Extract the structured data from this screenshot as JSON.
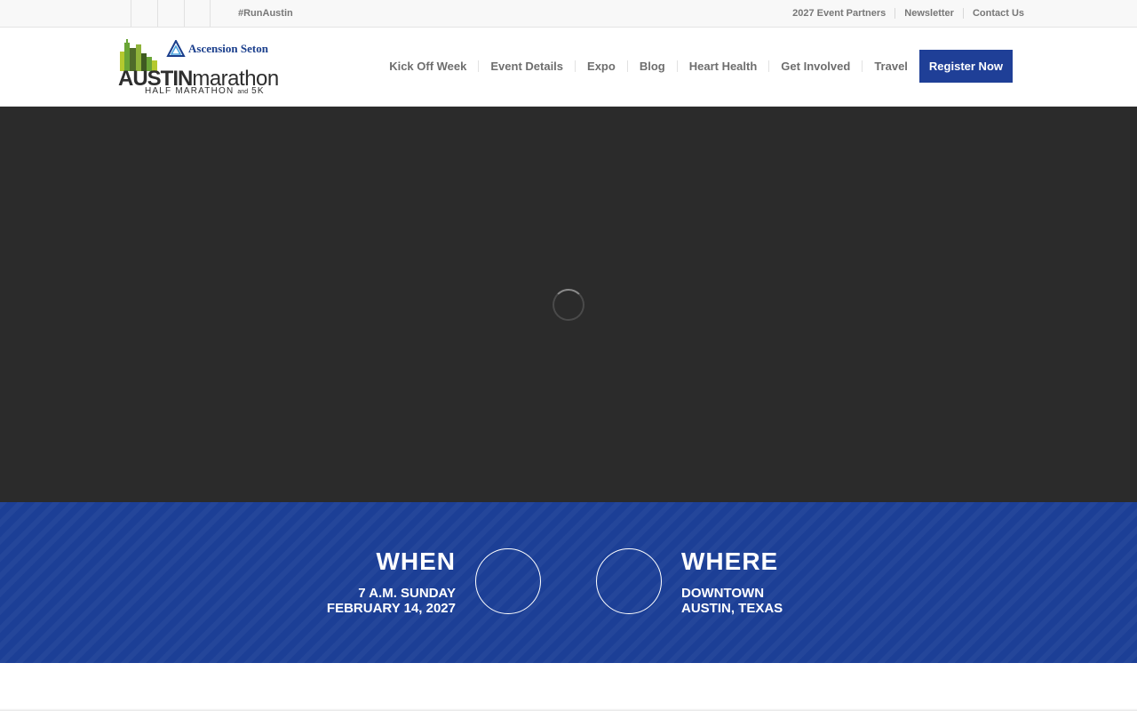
{
  "topbar": {
    "hashtag": "#RunAustin",
    "links": [
      "2027 Event Partners",
      "Newsletter",
      "Contact Us"
    ],
    "social_icons": [
      "social-icon",
      "social-icon",
      "social-icon"
    ]
  },
  "logo": {
    "sponsor": "Ascension Seton",
    "wordmark_bold": "AUSTIN",
    "wordmark_light": "marathon",
    "tagline_main": "HALF MARATHON",
    "tagline_small": "and",
    "tagline_end": "5K",
    "colors": {
      "skyline_green": "#6aa536",
      "skyline_olive": "#4f6b2a",
      "skyline_lime": "#b4c92e",
      "seton_blue": "#1a3e8c"
    }
  },
  "nav": {
    "items": [
      "Kick Off Week",
      "Event Details",
      "Expo",
      "Blog",
      "Heart Health",
      "Get Involved",
      "Travel"
    ],
    "cta": "Register Now"
  },
  "hero": {
    "state": "loading"
  },
  "band": {
    "when": {
      "title": "WHEN",
      "line1": "7 A.M. SUNDAY",
      "line2": "FEBRUARY 14, 2027"
    },
    "where": {
      "title": "WHERE",
      "line1": "DOWNTOWN",
      "line2": "AUSTIN, TEXAS"
    }
  },
  "colors": {
    "brand_blue": "#1f3f97",
    "band_blue": "#1c3f96",
    "hero_bg": "#2b2b2b"
  }
}
